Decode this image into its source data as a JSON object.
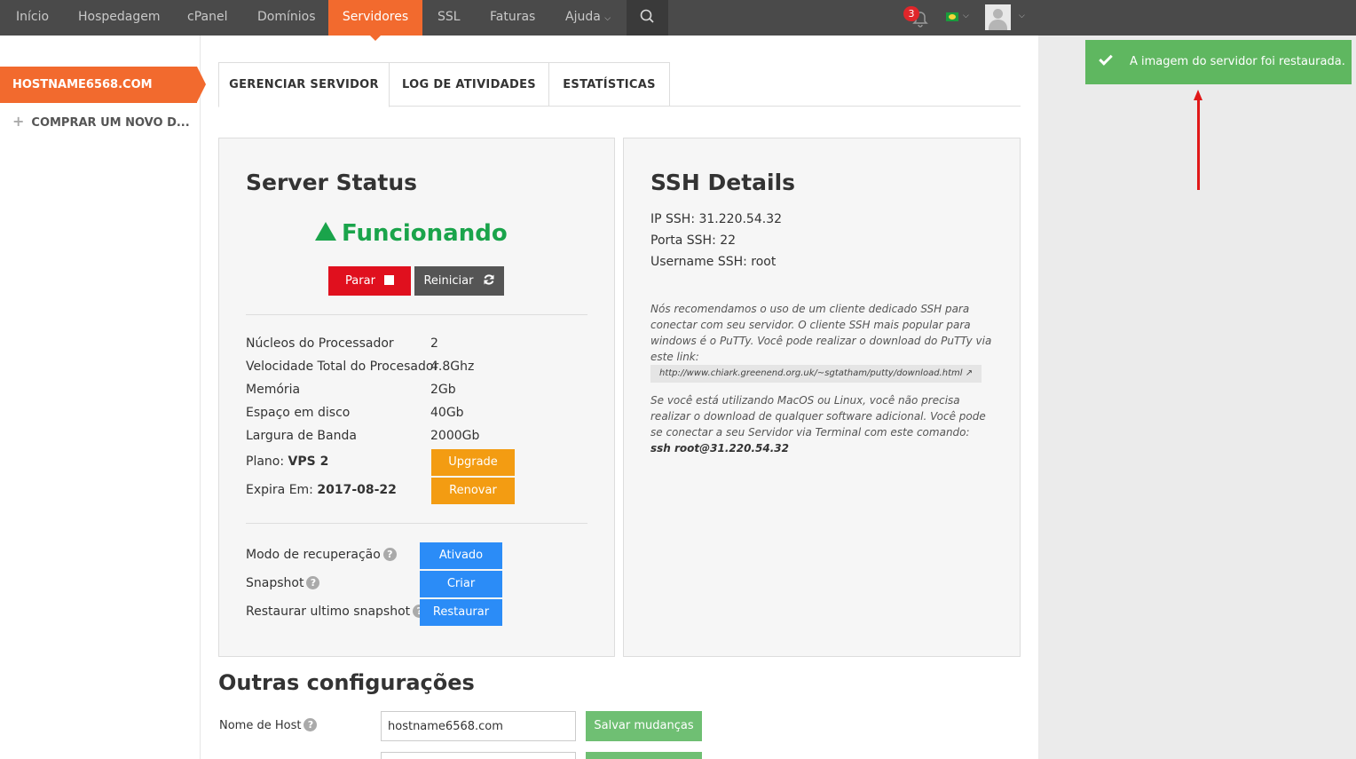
{
  "nav": {
    "items": [
      {
        "label": "Início"
      },
      {
        "label": "Hospedagem"
      },
      {
        "label": "cPanel"
      },
      {
        "label": "Domínios"
      },
      {
        "label": "Servidores"
      },
      {
        "label": "SSL"
      },
      {
        "label": "Faturas"
      },
      {
        "label": "Ajuda"
      }
    ],
    "notification_count": "3"
  },
  "sidebar": {
    "active_item": "HOSTNAME6568.COM",
    "buy_item": "COMPRAR UM NOVO D..."
  },
  "tabs": [
    {
      "label": "GERENCIAR SERVIDOR"
    },
    {
      "label": "LOG DE ATIVIDADES"
    },
    {
      "label": "ESTATÍSTICAS"
    }
  ],
  "server_status": {
    "title": "Server Status",
    "status": "Funcionando",
    "stop_label": "Parar",
    "restart_label": "Reiniciar",
    "specs": [
      {
        "label": "Núcleos do Processador",
        "value": "2"
      },
      {
        "label": "Velocidade Total do Procesador",
        "value": "4.8Ghz"
      },
      {
        "label": "Memória",
        "value": "2Gb"
      },
      {
        "label": "Espaço em disco",
        "value": "40Gb"
      },
      {
        "label": "Largura de Banda",
        "value": "2000Gb"
      }
    ],
    "plan_label": "Plano:",
    "plan_value": "VPS 2",
    "upgrade_label": "Upgrade",
    "expires_label": "Expira Em:",
    "expires_value": "2017-08-22",
    "renew_label": "Renovar",
    "recovery_label": "Modo de recuperação",
    "recovery_button": "Ativado",
    "snapshot_label": "Snapshot",
    "snapshot_button": "Criar",
    "restore_label": "Restaurar ultimo snapshot",
    "restore_button": "Restaurar"
  },
  "ssh": {
    "title": "SSH Details",
    "ip": "IP SSH: 31.220.54.32",
    "port": "Porta SSH: 22",
    "username": "Username SSH: root",
    "note1": "Nós recomendamos o uso de um cliente dedicado SSH para conectar com seu servidor. O cliente SSH mais popular para windows é o PuTTy. Você pode realizar o download do PuTTy via este link:",
    "link": "http://www.chiark.greenend.org.uk/~sgtatham/putty/download.html",
    "note2": "Se você está utilizando MacOS ou Linux, você não precisa realizar o download de qualquer software adicional. Você pode se conectar a seu Servidor via Terminal com este comando:",
    "command": "ssh root@31.220.54.32"
  },
  "other": {
    "title": "Outras configurações",
    "hostname_label": "Nome de Host",
    "hostname_value": "hostname6568.com",
    "save_label": "Salvar mudanças"
  },
  "toast": {
    "message": "A imagem do servidor foi restaurada."
  }
}
